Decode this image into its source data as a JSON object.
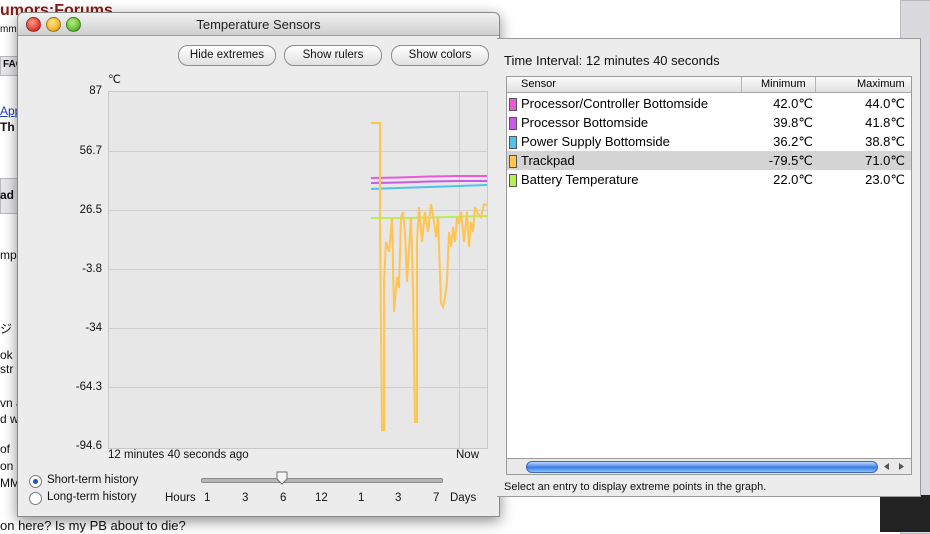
{
  "background": {
    "forum_brand": "umors:Forums",
    "forum_sub": "mmu",
    "frag_faq": "FAQ",
    "frag_app": "App",
    "frag_th": "Th",
    "frag_ad": "ad",
    "frag_mp": "mp",
    "frag_jp": "ジ",
    "frag_ok": "ok",
    "frag_str": "str",
    "frag_wn": "vn a",
    "frag_dw": "d w",
    "frag_of": "of",
    "frag_on": "on",
    "frag_mm": "MM",
    "frag_bottom": "on here? Is my PB about to die?"
  },
  "window": {
    "title": "Temperature Sensors",
    "buttons": {
      "hide_extremes": "Hide extremes",
      "show_rulers": "Show rulers",
      "show_colors": "Show colors"
    },
    "unit": "℃",
    "y_ticks": [
      "87",
      "56.7",
      "26.5",
      "-3.8",
      "-34",
      "-64.3",
      "-94.6"
    ],
    "x_left_label": "12 minutes 40 seconds ago",
    "x_right_label": "Now",
    "history": {
      "short_term": "Short-term history",
      "long_term": "Long-term history",
      "selected": "short_term"
    },
    "slider": {
      "hours_label": "Hours",
      "days_label": "Days",
      "ticks": [
        "1",
        "3",
        "6",
        "12",
        "1",
        "3",
        "7"
      ],
      "selected_index": 2
    }
  },
  "drawer": {
    "time_interval": "Time Interval: 12 minutes 40 seconds",
    "columns": {
      "sensor": "Sensor",
      "minimum": "Minimum",
      "maximum": "Maximum"
    },
    "rows": [
      {
        "name": "Processor/Controller Bottomside",
        "min": "42.0℃",
        "max": "44.0℃",
        "color": "#e85ad6"
      },
      {
        "name": "Processor Bottomside",
        "min": "39.8℃",
        "max": "41.8℃",
        "color": "#c95be6"
      },
      {
        "name": "Power Supply Bottomside",
        "min": "36.2℃",
        "max": "38.8℃",
        "color": "#4fc3ef"
      },
      {
        "name": "Trackpad",
        "min": "-79.5℃",
        "max": "71.0℃",
        "color": "#ffc451"
      },
      {
        "name": "Battery Temperature",
        "min": "22.0℃",
        "max": "23.0℃",
        "color": "#b6ef5a"
      }
    ],
    "selected_row": 3,
    "status": "Select an entry to display extreme points in the graph."
  }
}
